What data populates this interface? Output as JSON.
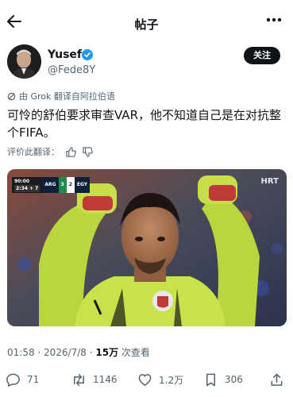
{
  "header": {
    "title": "帖子"
  },
  "author": {
    "name": "Yusef",
    "handle": "@Fede8Y",
    "follow_label": "关注"
  },
  "post": {
    "translated_label": "由 Grok 翻译自阿拉伯语",
    "text": "可怜的舒伯要求审查VAR，他不知道自己是在对抗整个FIFA。",
    "rate_label": "评价此翻译："
  },
  "media": {
    "scorebug": {
      "time": "90:00",
      "added": "2:34",
      "added_extra": "+ 7",
      "team1": "ARG",
      "score1": "3",
      "score2": "2",
      "team2": "EGY"
    },
    "broadcaster": "HRT"
  },
  "meta": {
    "time": "01:58",
    "date": "2026/7/8",
    "separator": " · ",
    "views_count": "15万",
    "views_label": " 次查看"
  },
  "actions": {
    "replies": "71",
    "reposts": "1146",
    "likes": "1.2万",
    "bookmarks": "306"
  },
  "colors": {
    "text": "#0f1419",
    "secondary": "#536471",
    "verified": "#1d9bf0",
    "jersey": "#c8e34a"
  }
}
